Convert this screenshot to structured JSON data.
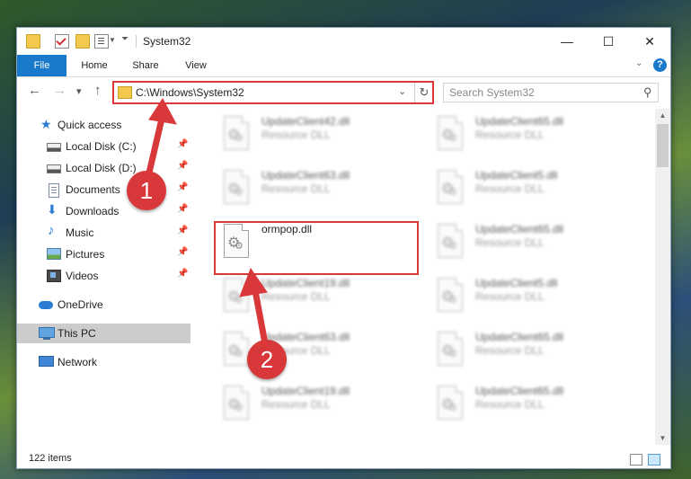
{
  "window": {
    "title": "System32",
    "controls": {
      "minimize": "—",
      "maximize": "☐",
      "close": "✕"
    },
    "help_label": "?"
  },
  "ribbon": {
    "tabs": [
      {
        "label": "File"
      },
      {
        "label": "Home"
      },
      {
        "label": "Share"
      },
      {
        "label": "View"
      }
    ]
  },
  "address_bar": {
    "path": "C:\\Windows\\System32",
    "refresh_glyph": "↻"
  },
  "search": {
    "placeholder": "Search System32",
    "icon": "search-icon"
  },
  "nav": {
    "back": "←",
    "forward": "→",
    "recent": "▾",
    "up": "↑"
  },
  "sidebar": {
    "pin_glyph": "📌",
    "items": [
      {
        "label": "Quick access",
        "icon": "star-icon",
        "pinned": false
      },
      {
        "label": "Local Disk (C:)",
        "icon": "disk-icon",
        "pinned": true
      },
      {
        "label": "Local Disk (D:)",
        "icon": "disk-icon",
        "pinned": true
      },
      {
        "label": "Documents",
        "icon": "documents-icon",
        "pinned": true
      },
      {
        "label": "Downloads",
        "icon": "downloads-icon",
        "pinned": true
      },
      {
        "label": "Music",
        "icon": "music-icon",
        "pinned": true
      },
      {
        "label": "Pictures",
        "icon": "pictures-icon",
        "pinned": true
      },
      {
        "label": "Videos",
        "icon": "videos-icon",
        "pinned": true
      },
      {
        "label": "OneDrive",
        "icon": "onedrive-icon",
        "pinned": false
      },
      {
        "label": "This PC",
        "icon": "this-pc-icon",
        "pinned": false,
        "selected": true
      },
      {
        "label": "Network",
        "icon": "network-icon",
        "pinned": false
      }
    ]
  },
  "files": [
    {
      "name": "UpdateClient42.dll",
      "type": "Resource DLL"
    },
    {
      "name": "UpdateClient65.dll",
      "type": "Resource DLL"
    },
    {
      "name": "UpdateClient63.dll",
      "type": "Resource DLL"
    },
    {
      "name": "UpdateClient5.dll",
      "type": "Resource DLL"
    },
    {
      "name": "ormpop.dll",
      "type": "",
      "highlighted": true
    },
    {
      "name": "UpdateClient65.dll",
      "type": "Resource DLL"
    },
    {
      "name": "UpdateClient19.dll",
      "type": "Resource DLL"
    },
    {
      "name": "UpdateClient5.dll",
      "type": "Resource DLL"
    },
    {
      "name": "UpdateClient63.dll",
      "type": "Resource DLL"
    },
    {
      "name": "UpdateClient65.dll",
      "type": "Resource DLL"
    },
    {
      "name": "UpdateClient19.dll",
      "type": "Resource DLL"
    },
    {
      "name": "UpdateClient65.dll",
      "type": "Resource DLL"
    }
  ],
  "status": {
    "item_count": "122 items"
  },
  "annotations": [
    {
      "label": "1"
    },
    {
      "label": "2"
    }
  ],
  "colors": {
    "accent": "#1979ca",
    "annotation_red": "#d9383a",
    "selected_nav": "#cccccc"
  }
}
